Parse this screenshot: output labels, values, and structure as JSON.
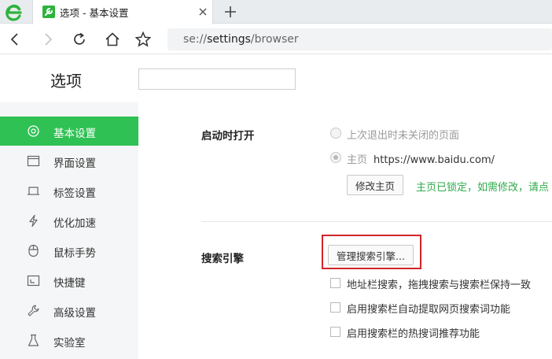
{
  "tab": {
    "title": "选项 - 基本设置"
  },
  "address": {
    "scheme": "se://",
    "host": "settings",
    "path": "/browser"
  },
  "page": {
    "title": "选项",
    "search_placeholder": ""
  },
  "sidebar": {
    "items": [
      {
        "label": "基本设置",
        "icon": "target-icon",
        "active": true
      },
      {
        "label": "界面设置",
        "icon": "window-icon",
        "active": false
      },
      {
        "label": "标签设置",
        "icon": "tab-icon",
        "active": false
      },
      {
        "label": "优化加速",
        "icon": "lightning-icon",
        "active": false
      },
      {
        "label": "鼠标手势",
        "icon": "mouse-icon",
        "active": false
      },
      {
        "label": "快捷键",
        "icon": "shortcut-icon",
        "active": false
      },
      {
        "label": "高级设置",
        "icon": "wrench-icon",
        "active": false
      },
      {
        "label": "实验室",
        "icon": "flask-icon",
        "active": false
      }
    ]
  },
  "startup": {
    "label": "启动时打开",
    "option_restore": "上次退出时未关闭的页面",
    "option_home": "主页",
    "home_url": "https://www.baidu.com/",
    "selected": "home",
    "modify_button": "修改主页",
    "lock_note": "主页已锁定，如需修改，请点"
  },
  "search": {
    "label": "搜索引擎",
    "manage_button": "管理搜索引擎...",
    "options": [
      {
        "label": "地址栏搜索，拖拽搜索与搜索栏保持一致",
        "checked": false
      },
      {
        "label": "启用搜索栏自动提取网页搜索词功能",
        "checked": false
      },
      {
        "label": "启用搜索栏的热搜词推荐功能",
        "checked": false
      }
    ]
  },
  "colors": {
    "accent": "#2fc153",
    "highlight": "#d0242a",
    "lock_note": "#2eaa4a"
  }
}
